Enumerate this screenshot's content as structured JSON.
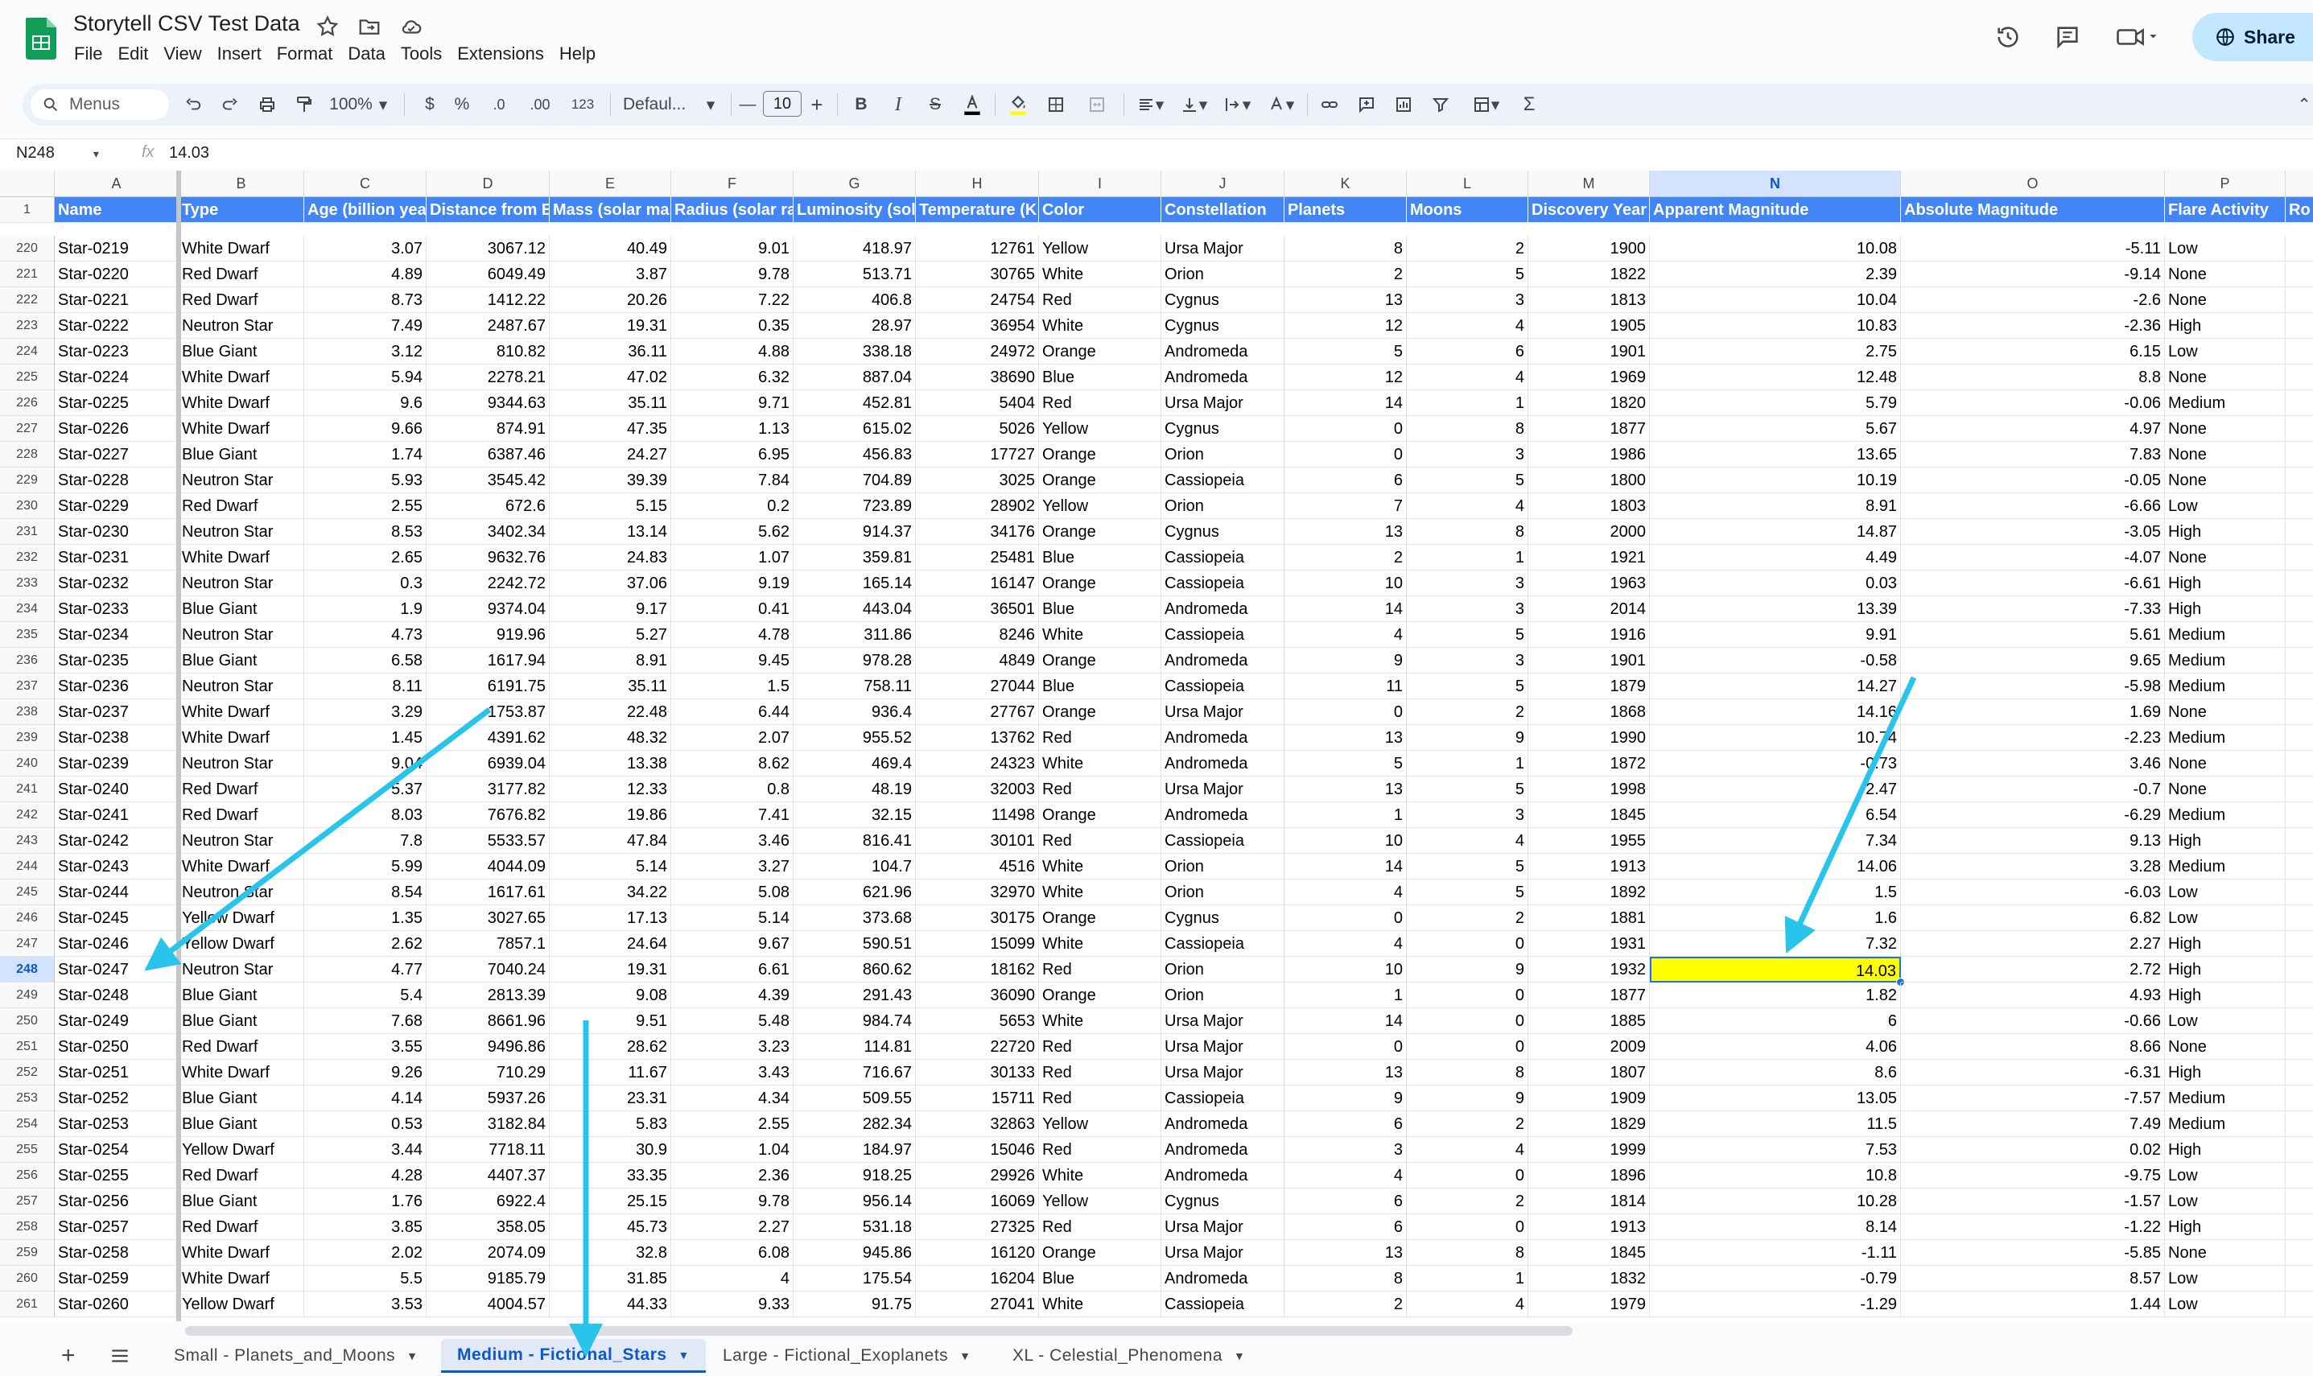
{
  "app": {
    "title": "Storytell CSV Test Data",
    "menu": [
      "File",
      "Edit",
      "View",
      "Insert",
      "Format",
      "Data",
      "Tools",
      "Extensions",
      "Help"
    ],
    "share_label": "Share"
  },
  "toolbar": {
    "search_label": "Menus",
    "zoom": "100%",
    "currency": "$",
    "percent": "%",
    "dec_decrease": ".0",
    "dec_increase": ".00",
    "number_format": "123",
    "font": "Defaul...",
    "font_size": "10"
  },
  "formula_bar": {
    "cell_ref": "N248",
    "fx": "fx",
    "value": "14.03"
  },
  "sheet": {
    "column_letters": [
      "A",
      "B",
      "C",
      "D",
      "E",
      "F",
      "G",
      "H",
      "I",
      "J",
      "K",
      "L",
      "M",
      "N",
      "O",
      "P"
    ],
    "header_row_number": "1",
    "headers": [
      "Name",
      "Type",
      "Age (billion yea",
      "Distance from E",
      "Mass (solar ma",
      "Radius (solar ra",
      "Luminosity (sol",
      "Temperature (K",
      "Color",
      "Constellation",
      "Planets",
      "Moons",
      "Discovery Year",
      "Apparent Magnitude",
      "Absolute Magnitude",
      "Flare Activity",
      "Ro"
    ],
    "selected_row": "248",
    "rows": [
      [
        "220",
        "Star-0219",
        "White Dwarf",
        "3.07",
        "3067.12",
        "40.49",
        "9.01",
        "418.97",
        "12761",
        "Yellow",
        "Ursa Major",
        "8",
        "2",
        "1900",
        "10.08",
        "-5.11",
        "Low"
      ],
      [
        "221",
        "Star-0220",
        "Red Dwarf",
        "4.89",
        "6049.49",
        "3.87",
        "9.78",
        "513.71",
        "30765",
        "White",
        "Orion",
        "2",
        "5",
        "1822",
        "2.39",
        "-9.14",
        "None"
      ],
      [
        "222",
        "Star-0221",
        "Red Dwarf",
        "8.73",
        "1412.22",
        "20.26",
        "7.22",
        "406.8",
        "24754",
        "Red",
        "Cygnus",
        "13",
        "3",
        "1813",
        "10.04",
        "-2.6",
        "None"
      ],
      [
        "223",
        "Star-0222",
        "Neutron Star",
        "7.49",
        "2487.67",
        "19.31",
        "0.35",
        "28.97",
        "36954",
        "White",
        "Cygnus",
        "12",
        "4",
        "1905",
        "10.83",
        "-2.36",
        "High"
      ],
      [
        "224",
        "Star-0223",
        "Blue Giant",
        "3.12",
        "810.82",
        "36.11",
        "4.88",
        "338.18",
        "24972",
        "Orange",
        "Andromeda",
        "5",
        "6",
        "1901",
        "2.75",
        "6.15",
        "Low"
      ],
      [
        "225",
        "Star-0224",
        "White Dwarf",
        "5.94",
        "2278.21",
        "47.02",
        "6.32",
        "887.04",
        "38690",
        "Blue",
        "Andromeda",
        "12",
        "4",
        "1969",
        "12.48",
        "8.8",
        "None"
      ],
      [
        "226",
        "Star-0225",
        "White Dwarf",
        "9.6",
        "9344.63",
        "35.11",
        "9.71",
        "452.81",
        "5404",
        "Red",
        "Ursa Major",
        "14",
        "1",
        "1820",
        "5.79",
        "-0.06",
        "Medium"
      ],
      [
        "227",
        "Star-0226",
        "White Dwarf",
        "9.66",
        "874.91",
        "47.35",
        "1.13",
        "615.02",
        "5026",
        "Yellow",
        "Cygnus",
        "0",
        "8",
        "1877",
        "5.67",
        "4.97",
        "None"
      ],
      [
        "228",
        "Star-0227",
        "Blue Giant",
        "1.74",
        "6387.46",
        "24.27",
        "6.95",
        "456.83",
        "17727",
        "Orange",
        "Orion",
        "0",
        "3",
        "1986",
        "13.65",
        "7.83",
        "None"
      ],
      [
        "229",
        "Star-0228",
        "Neutron Star",
        "5.93",
        "3545.42",
        "39.39",
        "7.84",
        "704.89",
        "3025",
        "Orange",
        "Cassiopeia",
        "6",
        "5",
        "1800",
        "10.19",
        "-0.05",
        "None"
      ],
      [
        "230",
        "Star-0229",
        "Red Dwarf",
        "2.55",
        "672.6",
        "5.15",
        "0.2",
        "723.89",
        "28902",
        "Yellow",
        "Orion",
        "7",
        "4",
        "1803",
        "8.91",
        "-6.66",
        "Low"
      ],
      [
        "231",
        "Star-0230",
        "Neutron Star",
        "8.53",
        "3402.34",
        "13.14",
        "5.62",
        "914.37",
        "34176",
        "Orange",
        "Cygnus",
        "13",
        "8",
        "2000",
        "14.87",
        "-3.05",
        "High"
      ],
      [
        "232",
        "Star-0231",
        "White Dwarf",
        "2.65",
        "9632.76",
        "24.83",
        "1.07",
        "359.81",
        "25481",
        "Blue",
        "Cassiopeia",
        "2",
        "1",
        "1921",
        "4.49",
        "-4.07",
        "None"
      ],
      [
        "233",
        "Star-0232",
        "Neutron Star",
        "0.3",
        "2242.72",
        "37.06",
        "9.19",
        "165.14",
        "16147",
        "Orange",
        "Cassiopeia",
        "10",
        "3",
        "1963",
        "0.03",
        "-6.61",
        "High"
      ],
      [
        "234",
        "Star-0233",
        "Blue Giant",
        "1.9",
        "9374.04",
        "9.17",
        "0.41",
        "443.04",
        "36501",
        "Blue",
        "Andromeda",
        "14",
        "3",
        "2014",
        "13.39",
        "-7.33",
        "High"
      ],
      [
        "235",
        "Star-0234",
        "Neutron Star",
        "4.73",
        "919.96",
        "5.27",
        "4.78",
        "311.86",
        "8246",
        "White",
        "Cassiopeia",
        "4",
        "5",
        "1916",
        "9.91",
        "5.61",
        "Medium"
      ],
      [
        "236",
        "Star-0235",
        "Blue Giant",
        "6.58",
        "1617.94",
        "8.91",
        "9.45",
        "978.28",
        "4849",
        "Orange",
        "Andromeda",
        "9",
        "3",
        "1901",
        "-0.58",
        "9.65",
        "Medium"
      ],
      [
        "237",
        "Star-0236",
        "Neutron Star",
        "8.11",
        "6191.75",
        "35.11",
        "1.5",
        "758.11",
        "27044",
        "Blue",
        "Cassiopeia",
        "11",
        "5",
        "1879",
        "14.27",
        "-5.98",
        "Medium"
      ],
      [
        "238",
        "Star-0237",
        "White Dwarf",
        "3.29",
        "1753.87",
        "22.48",
        "6.44",
        "936.4",
        "27767",
        "Orange",
        "Ursa Major",
        "0",
        "2",
        "1868",
        "14.16",
        "1.69",
        "None"
      ],
      [
        "239",
        "Star-0238",
        "White Dwarf",
        "1.45",
        "4391.62",
        "48.32",
        "2.07",
        "955.52",
        "13762",
        "Red",
        "Andromeda",
        "13",
        "9",
        "1990",
        "10.74",
        "-2.23",
        "Medium"
      ],
      [
        "240",
        "Star-0239",
        "Neutron Star",
        "9.04",
        "6939.04",
        "13.38",
        "8.62",
        "469.4",
        "24323",
        "White",
        "Andromeda",
        "5",
        "1",
        "1872",
        "-0.73",
        "3.46",
        "None"
      ],
      [
        "241",
        "Star-0240",
        "Red Dwarf",
        "5.37",
        "3177.82",
        "12.33",
        "0.8",
        "48.19",
        "32003",
        "Red",
        "Ursa Major",
        "13",
        "5",
        "1998",
        "2.47",
        "-0.7",
        "None"
      ],
      [
        "242",
        "Star-0241",
        "Red Dwarf",
        "8.03",
        "7676.82",
        "19.86",
        "7.41",
        "32.15",
        "11498",
        "Orange",
        "Andromeda",
        "1",
        "3",
        "1845",
        "6.54",
        "-6.29",
        "Medium"
      ],
      [
        "243",
        "Star-0242",
        "Neutron Star",
        "7.8",
        "5533.57",
        "47.84",
        "3.46",
        "816.41",
        "30101",
        "Red",
        "Cassiopeia",
        "10",
        "4",
        "1955",
        "7.34",
        "9.13",
        "High"
      ],
      [
        "244",
        "Star-0243",
        "White Dwarf",
        "5.99",
        "4044.09",
        "5.14",
        "3.27",
        "104.7",
        "4516",
        "White",
        "Orion",
        "14",
        "5",
        "1913",
        "14.06",
        "3.28",
        "Medium"
      ],
      [
        "245",
        "Star-0244",
        "Neutron Star",
        "8.54",
        "1617.61",
        "34.22",
        "5.08",
        "621.96",
        "32970",
        "White",
        "Orion",
        "4",
        "5",
        "1892",
        "1.5",
        "-6.03",
        "Low"
      ],
      [
        "246",
        "Star-0245",
        "Yellow Dwarf",
        "1.35",
        "3027.65",
        "17.13",
        "5.14",
        "373.68",
        "30175",
        "Orange",
        "Cygnus",
        "0",
        "2",
        "1881",
        "1.6",
        "6.82",
        "Low"
      ],
      [
        "247",
        "Star-0246",
        "Yellow Dwarf",
        "2.62",
        "7857.1",
        "24.64",
        "9.67",
        "590.51",
        "15099",
        "White",
        "Cassiopeia",
        "4",
        "0",
        "1931",
        "7.32",
        "2.27",
        "High"
      ],
      [
        "248",
        "Star-0247",
        "Neutron Star",
        "4.77",
        "7040.24",
        "19.31",
        "6.61",
        "860.62",
        "18162",
        "Red",
        "Orion",
        "10",
        "9",
        "1932",
        "14.03",
        "2.72",
        "High"
      ],
      [
        "249",
        "Star-0248",
        "Blue Giant",
        "5.4",
        "2813.39",
        "9.08",
        "4.39",
        "291.43",
        "36090",
        "Orange",
        "Orion",
        "1",
        "0",
        "1877",
        "1.82",
        "4.93",
        "High"
      ],
      [
        "250",
        "Star-0249",
        "Blue Giant",
        "7.68",
        "8661.96",
        "9.51",
        "5.48",
        "984.74",
        "5653",
        "White",
        "Ursa Major",
        "14",
        "0",
        "1885",
        "6",
        "-0.66",
        "Low"
      ],
      [
        "251",
        "Star-0250",
        "Red Dwarf",
        "3.55",
        "9496.86",
        "28.62",
        "3.23",
        "114.81",
        "22720",
        "Red",
        "Ursa Major",
        "0",
        "0",
        "2009",
        "4.06",
        "8.66",
        "None"
      ],
      [
        "252",
        "Star-0251",
        "White Dwarf",
        "9.26",
        "710.29",
        "11.67",
        "3.43",
        "716.67",
        "30133",
        "Red",
        "Ursa Major",
        "13",
        "8",
        "1807",
        "8.6",
        "-6.31",
        "High"
      ],
      [
        "253",
        "Star-0252",
        "Blue Giant",
        "4.14",
        "5937.26",
        "23.31",
        "4.34",
        "509.55",
        "15711",
        "Red",
        "Cassiopeia",
        "9",
        "9",
        "1909",
        "13.05",
        "-7.57",
        "Medium"
      ],
      [
        "254",
        "Star-0253",
        "Blue Giant",
        "0.53",
        "3182.84",
        "5.83",
        "2.55",
        "282.34",
        "32863",
        "Yellow",
        "Andromeda",
        "6",
        "2",
        "1829",
        "11.5",
        "7.49",
        "Medium"
      ],
      [
        "255",
        "Star-0254",
        "Yellow Dwarf",
        "3.44",
        "7718.11",
        "30.9",
        "1.04",
        "184.97",
        "15046",
        "Red",
        "Andromeda",
        "3",
        "4",
        "1999",
        "7.53",
        "0.02",
        "High"
      ],
      [
        "256",
        "Star-0255",
        "Red Dwarf",
        "4.28",
        "4407.37",
        "33.35",
        "2.36",
        "918.25",
        "29926",
        "White",
        "Andromeda",
        "4",
        "0",
        "1896",
        "10.8",
        "-9.75",
        "Low"
      ],
      [
        "257",
        "Star-0256",
        "Blue Giant",
        "1.76",
        "6922.4",
        "25.15",
        "9.78",
        "956.14",
        "16069",
        "Yellow",
        "Cygnus",
        "6",
        "2",
        "1814",
        "10.28",
        "-1.57",
        "Low"
      ],
      [
        "258",
        "Star-0257",
        "Red Dwarf",
        "3.85",
        "358.05",
        "45.73",
        "2.27",
        "531.18",
        "27325",
        "Red",
        "Ursa Major",
        "6",
        "0",
        "1913",
        "8.14",
        "-1.22",
        "High"
      ],
      [
        "259",
        "Star-0258",
        "White Dwarf",
        "2.02",
        "2074.09",
        "32.8",
        "6.08",
        "945.86",
        "16120",
        "Orange",
        "Ursa Major",
        "13",
        "8",
        "1845",
        "-1.11",
        "-5.85",
        "None"
      ],
      [
        "260",
        "Star-0259",
        "White Dwarf",
        "5.5",
        "9185.79",
        "31.85",
        "4",
        "175.54",
        "16204",
        "Blue",
        "Andromeda",
        "8",
        "1",
        "1832",
        "-0.79",
        "8.57",
        "Low"
      ],
      [
        "261",
        "Star-0260",
        "Yellow Dwarf",
        "3.53",
        "4004.57",
        "44.33",
        "9.33",
        "91.75",
        "27041",
        "White",
        "Cassiopeia",
        "2",
        "4",
        "1979",
        "-1.29",
        "1.44",
        "Low"
      ]
    ]
  },
  "tabs": [
    "Small - Planets_and_Moons",
    "Medium - Fictional_Stars",
    "Large - Fictional_Exoplanets",
    "XL - Celestial_Phenomena"
  ],
  "active_tab": 1,
  "colors": {
    "header_fill": "#4285f4",
    "selection": "#1a73e8",
    "highlight": "#ffff00",
    "annotation_arrow": "#29c4ec"
  }
}
